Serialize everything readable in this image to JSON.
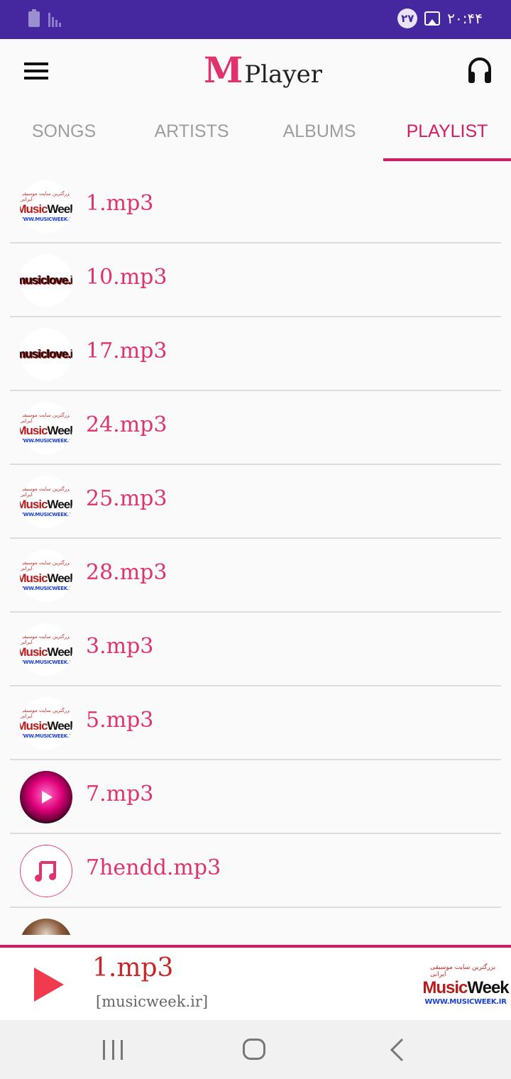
{
  "status_bar": {
    "notification_count": "٢٧",
    "time": "٢٠:۴۴"
  },
  "app": {
    "title_initial": "M",
    "title_rest": "Player"
  },
  "tabs": [
    {
      "label": "SONGS",
      "active": false
    },
    {
      "label": "ARTISTS",
      "active": false
    },
    {
      "label": "ALBUMS",
      "active": false
    },
    {
      "label": "PLAYLIST",
      "active": true
    }
  ],
  "thumb_text": {
    "musicweek_farsi": "بزرگترین سایت موسیقی ایرانی",
    "musicweek_music": "Music",
    "musicweek_week": "Week",
    "musicweek_www": "WWW.MUSICWEEK.IR",
    "musiclove": "musiclove.ir"
  },
  "playlist": [
    {
      "label": "1.mp3",
      "art": "musicweek"
    },
    {
      "label": "10.mp3",
      "art": "musiclove"
    },
    {
      "label": "17.mp3",
      "art": "musiclove"
    },
    {
      "label": "24.mp3",
      "art": "musicweek"
    },
    {
      "label": "25.mp3",
      "art": "musicweek"
    },
    {
      "label": "28.mp3",
      "art": "musicweek"
    },
    {
      "label": "3.mp3",
      "art": "musicweek"
    },
    {
      "label": "5.mp3",
      "art": "musicweek"
    },
    {
      "label": "7.mp3",
      "art": "pink-player"
    },
    {
      "label": "7hendd.mp3",
      "art": "music-note"
    },
    {
      "label": "",
      "art": "photo"
    }
  ],
  "now_playing": {
    "title": "1.mp3",
    "artist": "[musicweek.ir]"
  },
  "colors": {
    "status_bar": "#4527a0",
    "accent": "#d81b60",
    "item_text": "#e0336e"
  }
}
